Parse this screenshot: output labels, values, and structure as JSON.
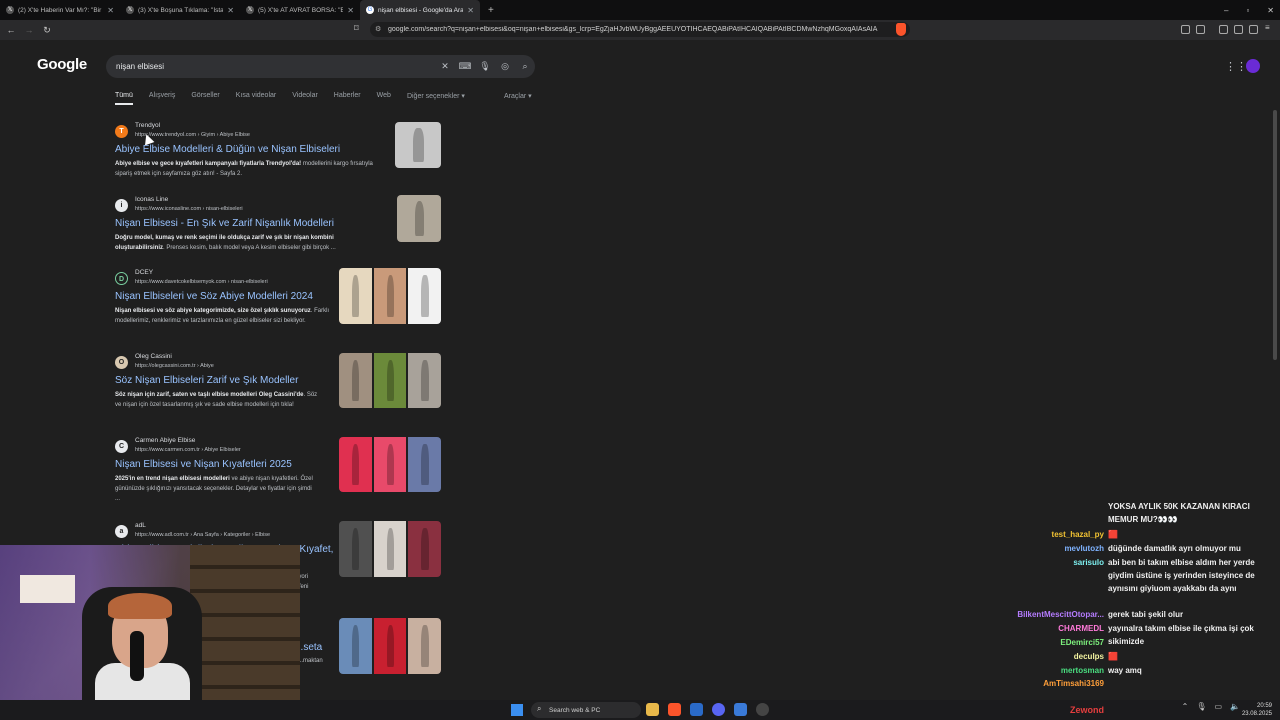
{
  "browser": {
    "tabs": [
      {
        "label": "(2) X'te Haberin Var Mı?: \"Bir çift, \"So...",
        "icon": "x-icon"
      },
      {
        "label": "(3) X'te Boşuna Tıklama: \"İstanbul'da...",
        "icon": "x-icon"
      },
      {
        "label": "(5) X'te AT AVRAT BORSA: \"Evlilik yo...",
        "icon": "x-icon"
      },
      {
        "label": "nişan elbisesi - Google'da Ara",
        "icon": "google-icon"
      }
    ],
    "new_tab": "+",
    "url": "google.com/search?q=nişan+elbisesi&oq=nişan+elbisesi&gs_lcrp=EgZjaHJvbWUyBggAEEUYOTIHCAEQABiPAtIHCAIQABiPAtIBCDMwNzhqMGoxqAIAsAIA..."
  },
  "google": {
    "logo": "Google",
    "query": "nişan elbisesi",
    "tabs": [
      "Tümü",
      "Alışveriş",
      "Görseller",
      "Kısa videolar",
      "Videolar",
      "Haberler",
      "Web",
      "Diğer seçenekler ▾"
    ],
    "tools": "Araçlar ▾"
  },
  "results": [
    {
      "site": "Trendyol",
      "url": "https://www.trendyol.com › Giyim › Abiye Elbise",
      "title": "Abiye Elbise Modelleri & Düğün ve Nişan Elbiseleri",
      "snippet_bold": "Abiye elbise ve gece kıyafetleri kampanyalı fiyatlarla Trendyol'da!",
      "snippet": " modellerini kargo fırsatıyla sipariş etmek için sayfamıza göz atın! - Sayfa 2.",
      "favicon": "T"
    },
    {
      "site": "Iconas Line",
      "url": "https://www.iconasline.com › nisan-elbiseleri",
      "title": "Nişan Elbisesi - En Şık ve Zarif Nişanlık Modelleri",
      "snippet_bold": "Doğru model, kumaş ve renk seçimi ile oldukça zarif ve şık bir nişan kombini oluşturabilirsiniz",
      "snippet": ". Prenses kesim, balık model veya A kesim elbiseler gibi birçok ...",
      "favicon": "i"
    },
    {
      "site": "DCEY",
      "url": "https://www.davetcokelbisemyok.com › nisan-elbiseleri",
      "title": "Nişan Elbiseleri ve Söz Abiye Modelleri 2024",
      "snippet_bold": "Nişan elbisesi ve söz abiye kategorimizde, size özel şıklık sunuyoruz",
      "snippet": ". Farklı modellerimiz, renklerimiz ve tarzlarımızla en güzel elbiseler sizi bekliyor.",
      "favicon": "D"
    },
    {
      "site": "Oleg Cassini",
      "url": "https://olegcassini.com.tr › Abiye",
      "title": "Söz Nişan Elbiseleri Zarif ve Şık Modeller",
      "snippet_bold": "Söz nişan için zarif, saten ve taşlı elbise modelleri Oleg Cassini'de",
      "snippet": ". Söz ve nişan için özel tasarlanmış şık ve sade elbise modelleri için tıkla!",
      "favicon": "O"
    },
    {
      "site": "Carmen Abiye Elbise",
      "url": "https://www.carmen.com.tr › Abiye Elbiseler",
      "title": "Nişan Elbisesi ve Nişan Kıyafetleri 2025",
      "snippet_bold": "2025'in en trend nişan elbisesi modelleri",
      "snippet": " ve abiye nişan kıyafetleri. Özel gününüzde şıklığınızı yansıtacak seçenekler. Detaylar ve fiyatlar için şimdi ...",
      "favicon": "C"
    },
    {
      "site": "adL",
      "url": "https://www.adl.com.tr › Ana Sayfa › Kategoriler › Elbise",
      "title": "Abiye Elbise Modelleri & Düğün ve Nişan Kıyafet,",
      "snippet_bold": "",
      "snippet": "",
      "favicon": "a"
    }
  ],
  "result7": {
    "title": "...seta",
    "snippet": "...maktan"
  },
  "result6_extra": {
    "line1": "iyori",
    "line2": "Yeni"
  },
  "chat": [
    {
      "user": "",
      "text": "YOKSA AYLIK 50K KAZANAN KIRACI MEMUR MU?👀👀",
      "color": "#ffffff"
    },
    {
      "user": "test_hazal_py",
      "text": "🟥",
      "color": "#f1c232"
    },
    {
      "user": "mevlutozh",
      "text": "düğünde damatlık ayrı olmuyor mu",
      "color": "#7fb3ff"
    },
    {
      "user": "sarisulo",
      "text": "abi ben bi takım elbise aldım her yerde giydim üstüne iş yerinden isteyince de aynısını giyiuom ayakkabı da aynı",
      "color": "#7ef0f0"
    },
    {
      "user": "BilkentMescittOtopar...",
      "text": "gerek tabi şekil olur",
      "color": "#b57cff"
    },
    {
      "user": "CHARMEDL",
      "text": "yayınalra takım elbise ile çıkma işi çok sikimizde",
      "color": "#ff7ad9"
    },
    {
      "user": "EDemirci57",
      "text": "",
      "color": "#7df07d"
    },
    {
      "user": "deculps",
      "text": "🟥",
      "color": "#f3f3a0"
    },
    {
      "user": "mertosman",
      "text": "way amq",
      "color": "#4ade80"
    },
    {
      "user": "AmTimsahi3169",
      "text": "",
      "color": "#ff9f3a"
    }
  ],
  "taskbar": {
    "search_placeholder": "Search web & PC",
    "time": "20:59",
    "date": "23.08.2025",
    "streamer": "Zewond"
  }
}
